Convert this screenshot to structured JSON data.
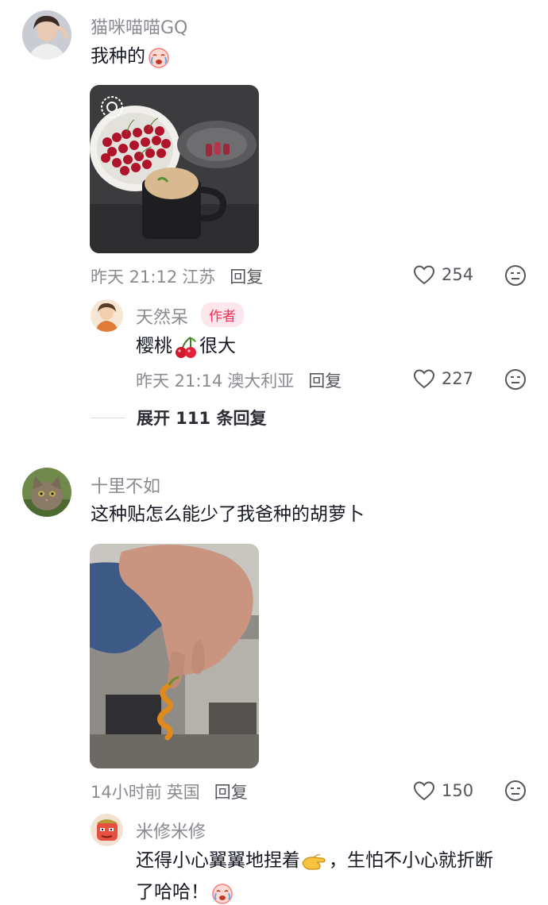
{
  "comments": [
    {
      "username": "猫咪喵喵GQ",
      "text": "我种的",
      "emoji": "crying-face",
      "image": "cherries-bowl-and-tea-photo",
      "time": "昨天 21:12",
      "location": "江苏",
      "reply_label": "回复",
      "likes": "254",
      "replies": [
        {
          "username": "天然呆",
          "badge": "作者",
          "text_before": "樱桃",
          "emoji": "cherry",
          "text_after": "很大",
          "time": "昨天 21:14",
          "location": "澳大利亚",
          "reply_label": "回复",
          "likes": "227"
        }
      ],
      "expand_label": "展开 111 条回复"
    },
    {
      "username": "十里不如",
      "text": "这种贴怎么能少了我爸种的胡萝卜",
      "image": "hand-holding-curly-carrot-photo",
      "time": "14小时前",
      "location": "英国",
      "reply_label": "回复",
      "likes": "150",
      "replies": [
        {
          "username": "米修米修",
          "text_line1_before": "还得小心翼翼地捏着",
          "emoji1": "pinching-hand",
          "text_line1_after": "，生怕不小心就折断",
          "text_line2": "了哈哈！",
          "emoji2": "crying-face"
        }
      ]
    }
  ],
  "colors": {
    "username": "#8a8b91",
    "text": "#161823",
    "meta": "#8a8b91",
    "author_badge_bg": "#fde7ec",
    "author_badge_text": "#fe2c55"
  }
}
